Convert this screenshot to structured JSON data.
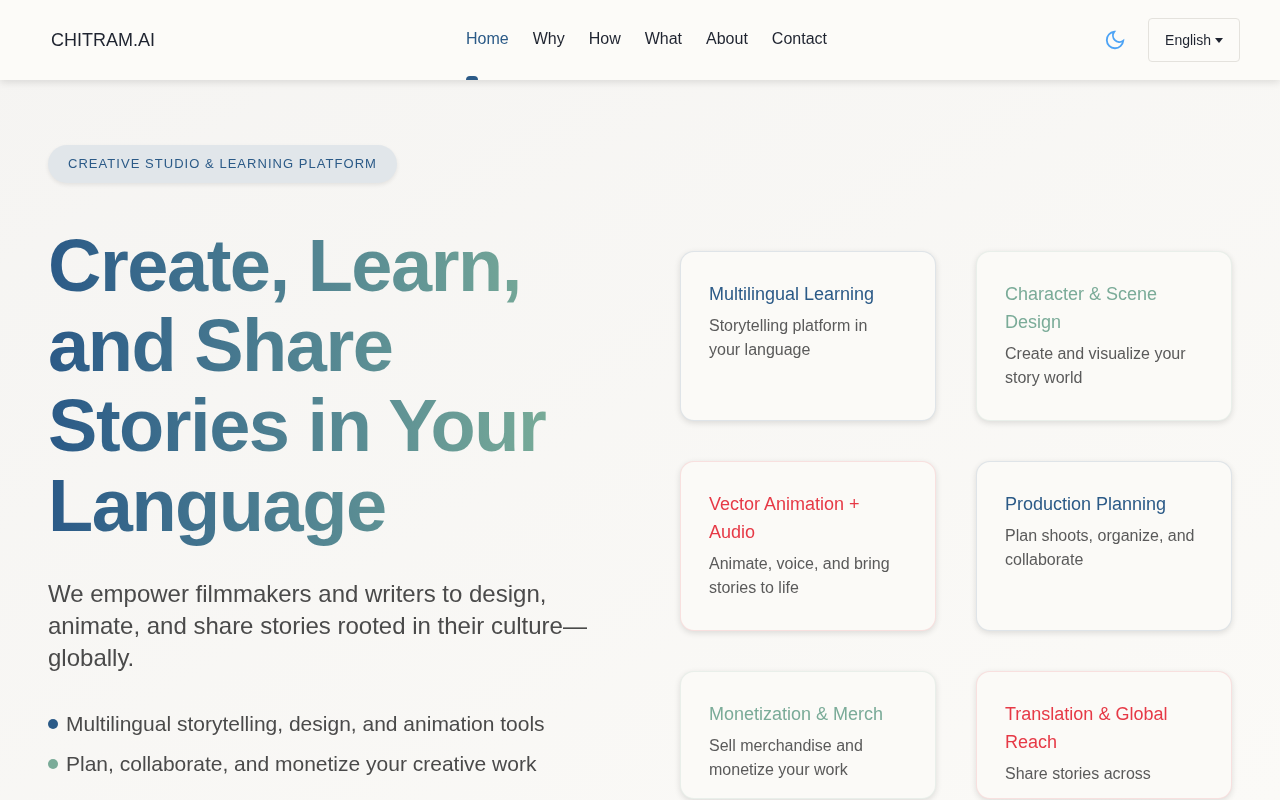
{
  "header": {
    "logo": "CHITRAM.AI",
    "nav": [
      {
        "label": "Home",
        "selected": true
      },
      {
        "label": "Why",
        "selected": false
      },
      {
        "label": "How",
        "selected": false
      },
      {
        "label": "What",
        "selected": false
      },
      {
        "label": "About",
        "selected": false
      },
      {
        "label": "Contact",
        "selected": false
      }
    ],
    "language": "English"
  },
  "hero": {
    "badge": "CREATIVE STUDIO & LEARNING PLATFORM",
    "title_lines": [
      "Create, Learn,",
      "and Share",
      "Stories in Your",
      "Language"
    ],
    "lead": "We empower filmmakers and writers to design, animate, and share stories rooted in their culture—globally.",
    "bullets": [
      {
        "text": "Multilingual storytelling, design, and animation tools",
        "color": "#2b5a87"
      },
      {
        "text": "Plan, collaborate, and monetize your creative work",
        "color": "#7aab98"
      }
    ]
  },
  "features": [
    {
      "title": "Multilingual Learning",
      "description": "Storytelling platform in your language",
      "color": "#2b5a87"
    },
    {
      "title": "Character & Scene Design",
      "description": "Create and visualize your story world",
      "color": "#7aab98"
    },
    {
      "title": "Vector Animation + Audio",
      "description": "Animate, voice, and bring stories to life",
      "color": "#e63946"
    },
    {
      "title": "Production Planning",
      "description": "Plan shoots, organize, and collaborate",
      "color": "#2b5a87"
    },
    {
      "title": "Monetization & Merch",
      "description": "Sell merchandise and monetize your work",
      "color": "#7aab98"
    },
    {
      "title": "Translation & Global Reach",
      "description": "Share stories across",
      "color": "#e63946"
    }
  ]
}
